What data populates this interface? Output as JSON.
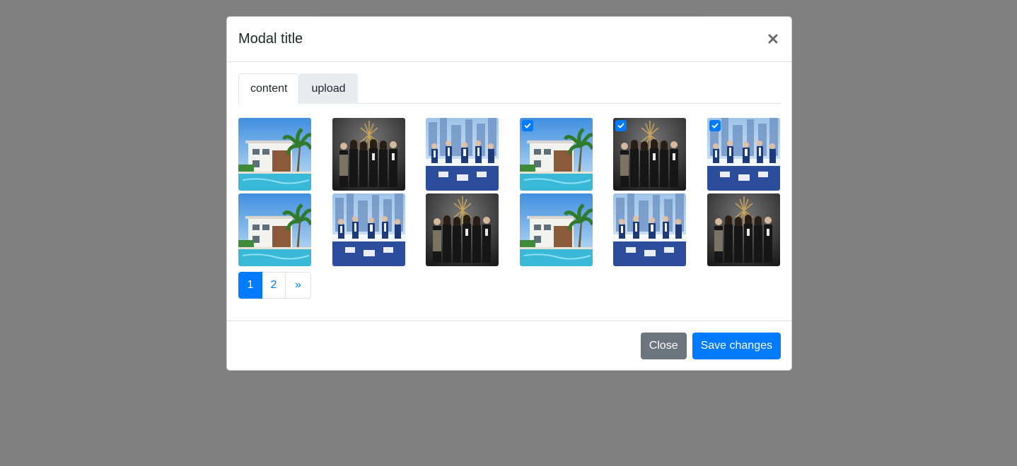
{
  "modal": {
    "title": "Modal title",
    "close_icon": "close-icon",
    "tabs": [
      {
        "label": "content",
        "active": true
      },
      {
        "label": "upload",
        "active": false
      }
    ],
    "images": [
      {
        "kind": "house",
        "checked": false
      },
      {
        "kind": "team",
        "checked": false
      },
      {
        "kind": "office",
        "checked": false
      },
      {
        "kind": "house",
        "checked": true
      },
      {
        "kind": "team",
        "checked": true
      },
      {
        "kind": "office",
        "checked": true
      },
      {
        "kind": "house",
        "checked": false
      },
      {
        "kind": "office",
        "checked": false
      },
      {
        "kind": "team",
        "checked": false
      },
      {
        "kind": "house",
        "checked": false
      },
      {
        "kind": "office",
        "checked": false
      },
      {
        "kind": "team",
        "checked": false
      }
    ],
    "pagination": {
      "pages": [
        "1",
        "2"
      ],
      "active": "1",
      "next_label": "»"
    },
    "footer": {
      "close_label": "Close",
      "save_label": "Save changes"
    }
  },
  "colors": {
    "backdrop": "#808080",
    "primary": "#007bff",
    "secondary": "#6c757d"
  }
}
